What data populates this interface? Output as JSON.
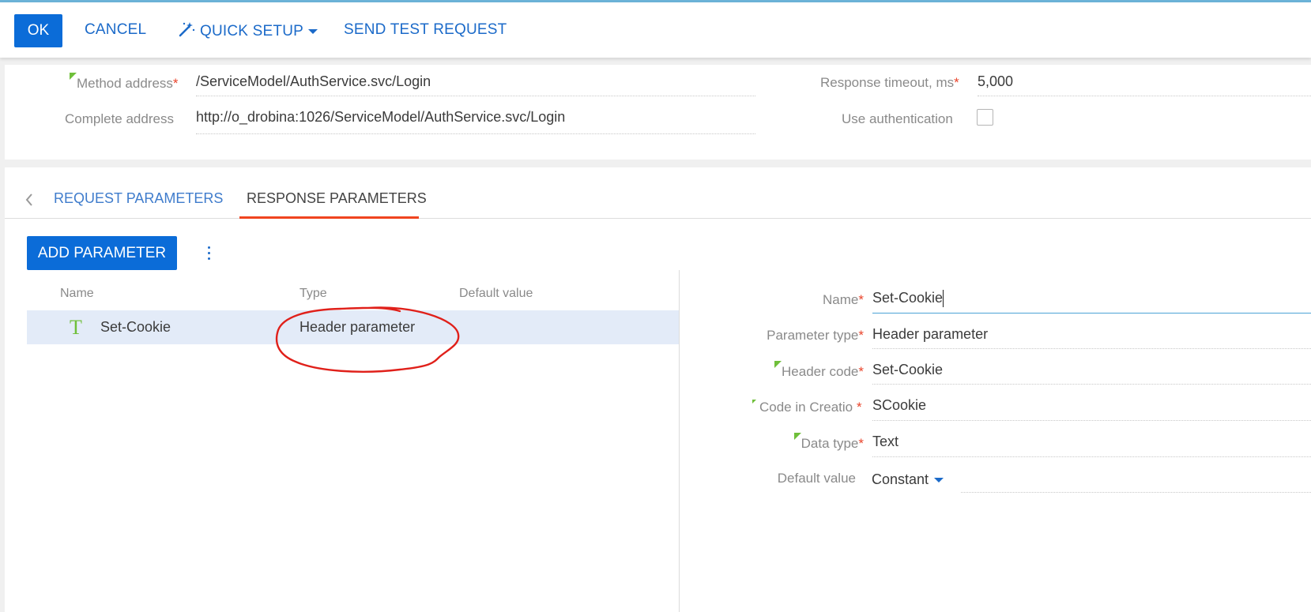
{
  "toolbar": {
    "ok_label": "OK",
    "cancel_label": "CANCEL",
    "quick_setup_label": "QUICK SETUP",
    "send_test_label": "SEND TEST REQUEST"
  },
  "settings": {
    "method_address": {
      "label": "Method address",
      "value": "/ServiceModel/AuthService.svc/Login"
    },
    "complete_address": {
      "label": "Complete address",
      "value": "http://o_drobina:1026/ServiceModel/AuthService.svc/Login"
    },
    "response_timeout": {
      "label": "Response timeout, ms",
      "value": "5,000"
    },
    "use_authentication": {
      "label": "Use authentication",
      "checked": false
    }
  },
  "tabs": [
    {
      "label": "REQUEST PARAMETERS",
      "active": false
    },
    {
      "label": "RESPONSE PARAMETERS",
      "active": true
    }
  ],
  "grid": {
    "add_label": "ADD PARAMETER",
    "columns": [
      "Name",
      "Type",
      "Default value"
    ],
    "rows": [
      {
        "type_icon": "T",
        "name": "Set-Cookie",
        "type": "Header parameter",
        "default": ""
      }
    ]
  },
  "details": {
    "name": {
      "label": "Name",
      "value": "Set-Cookie"
    },
    "parameter_type": {
      "label": "Parameter type",
      "value": "Header parameter"
    },
    "header_code": {
      "label": "Header code",
      "value": "Set-Cookie"
    },
    "code_in_creatio": {
      "label": "Code in Creatio",
      "value": "SCookie"
    },
    "data_type": {
      "label": "Data type",
      "value": "Text"
    },
    "default_value": {
      "label": "Default value",
      "value": "Constant"
    }
  },
  "colors": {
    "primary": "#0b6cd8",
    "link": "#1b6ac9",
    "required": "#e9442b",
    "active_tab_underline": "#f0441f",
    "selected_row": "#e3ebf8",
    "annotation": "#e0201a"
  }
}
